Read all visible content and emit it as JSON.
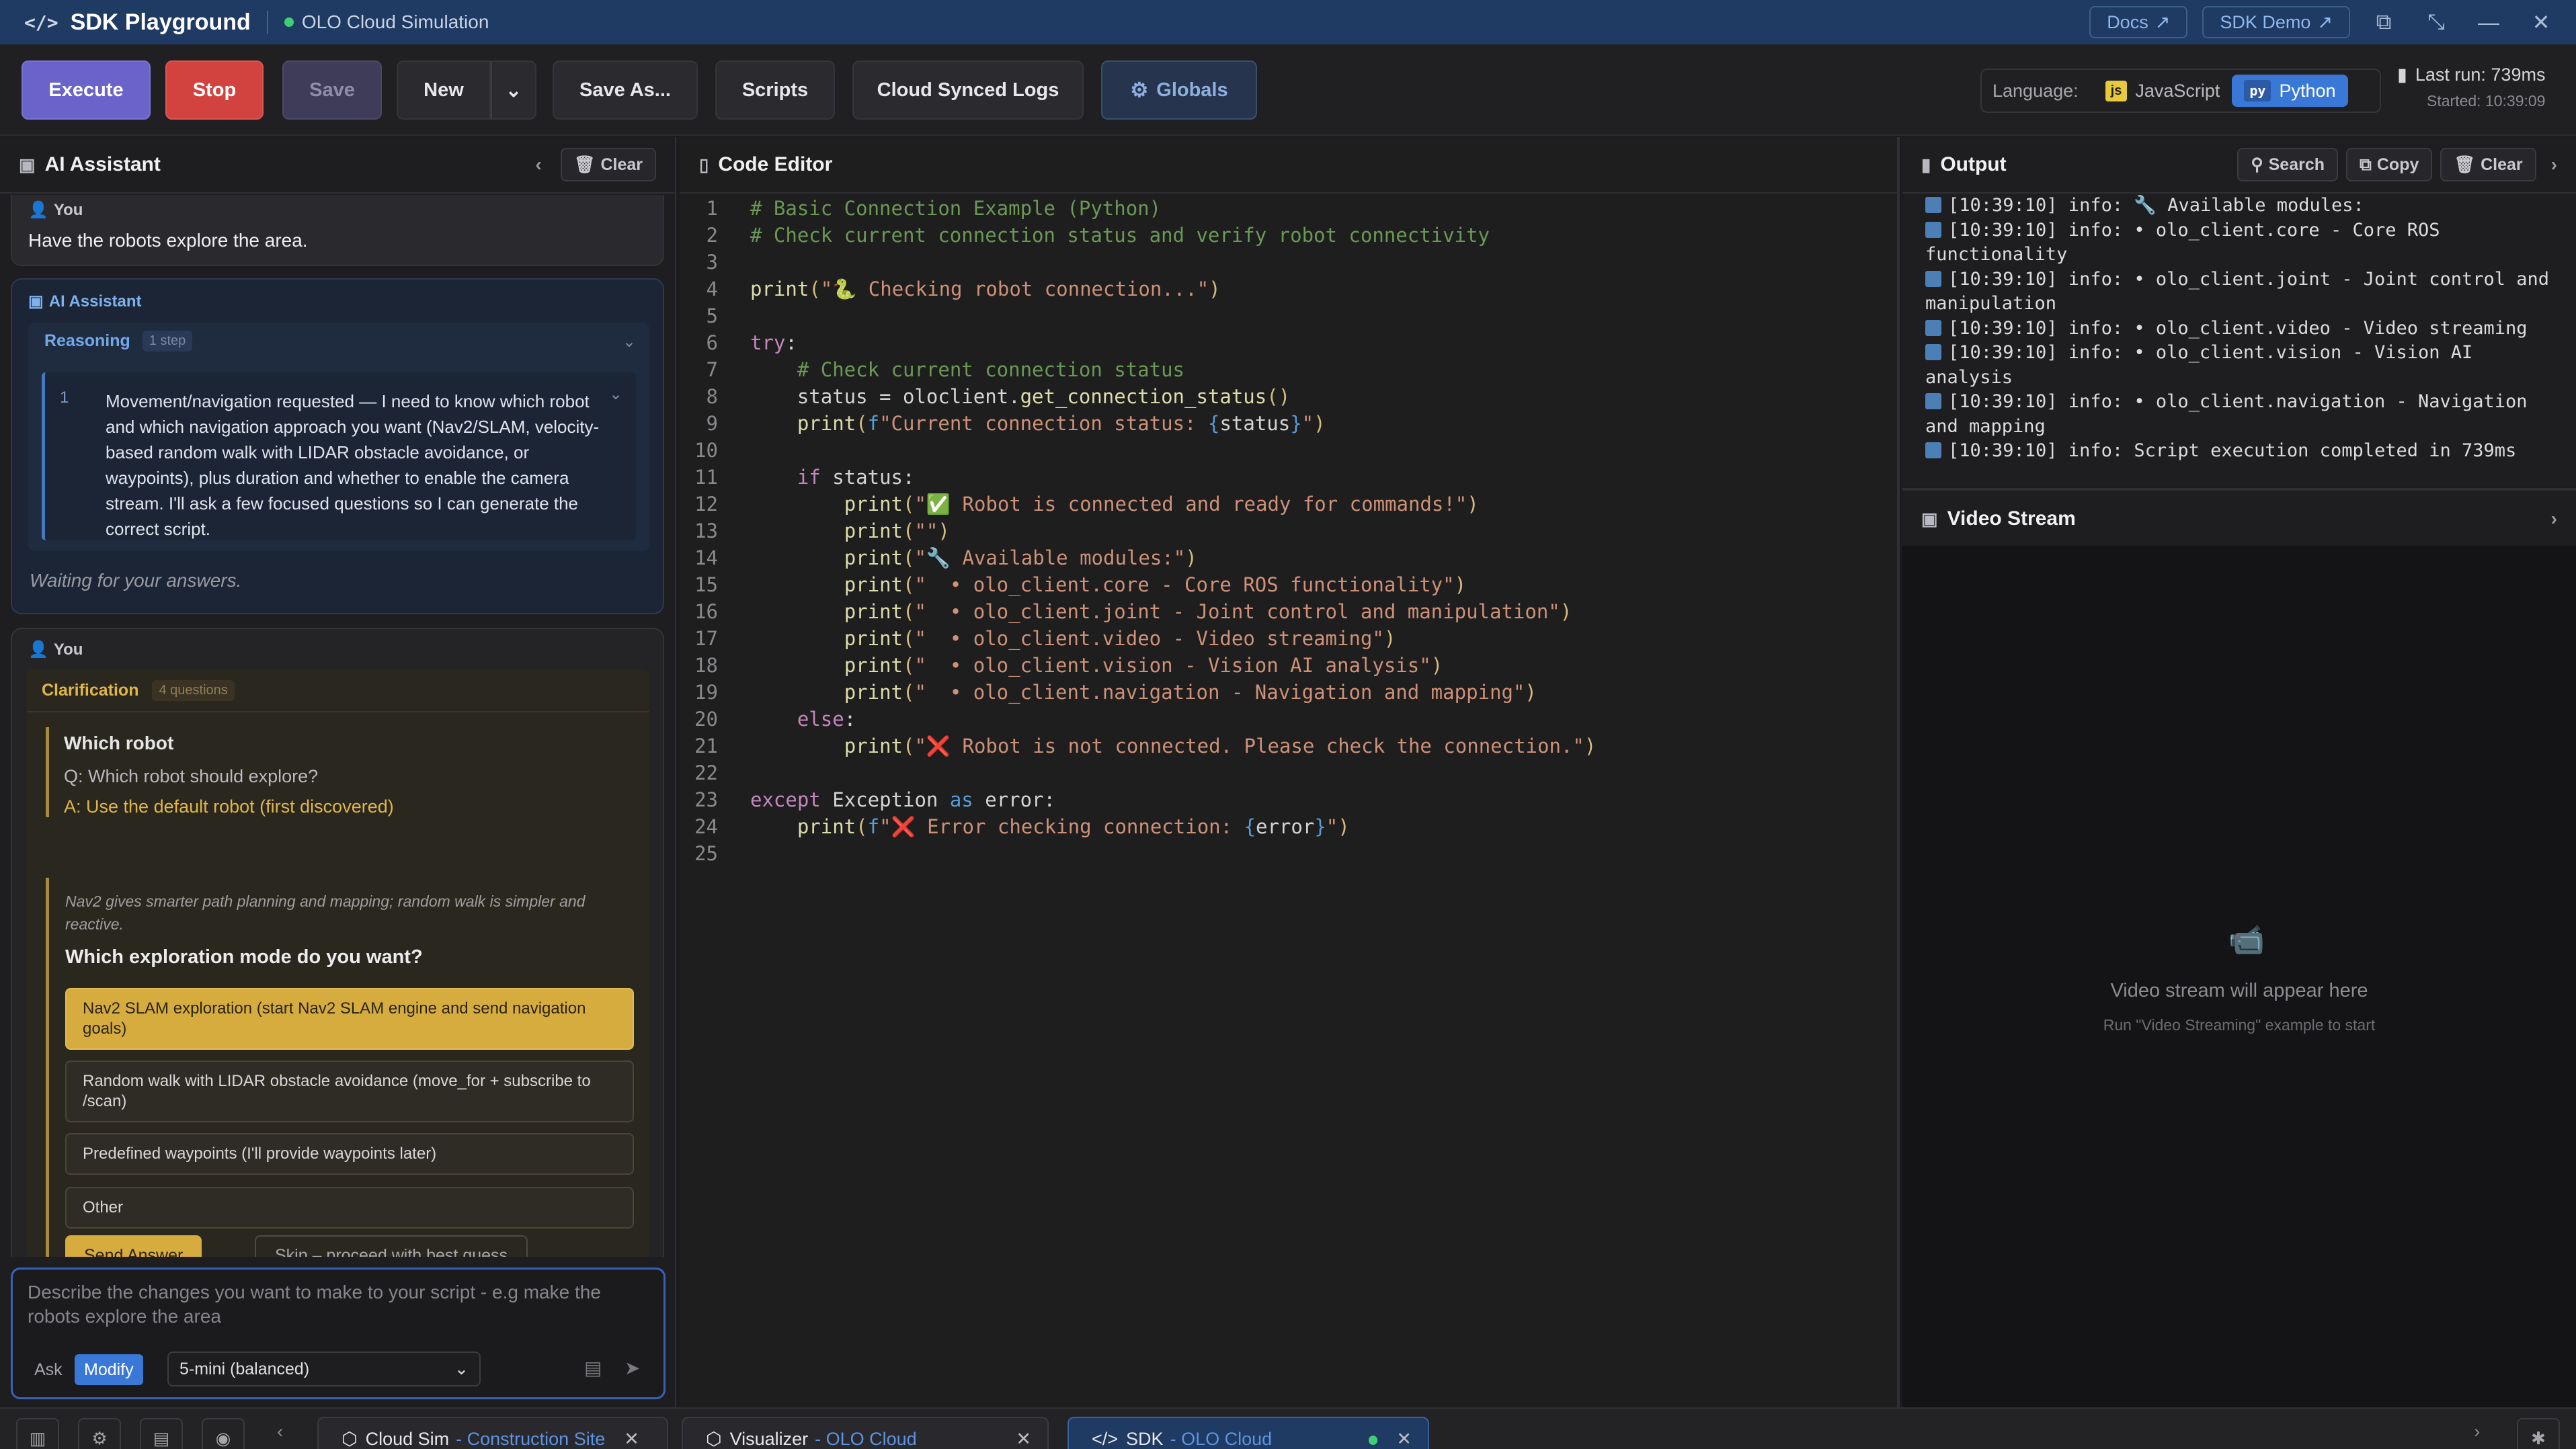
{
  "titlebar": {
    "app_name": "SDK Playground",
    "sim_name": "OLO Cloud Simulation",
    "docs": "Docs",
    "sdk_demo": "SDK Demo"
  },
  "toolbar": {
    "execute": "Execute",
    "stop": "Stop",
    "save": "Save",
    "new": "New",
    "save_as": "Save As...",
    "scripts": "Scripts",
    "cloud_logs": "Cloud Synced Logs",
    "globals": "Globals",
    "language_label": "Language:",
    "lang_js": "JavaScript",
    "lang_py": "Python",
    "lang_js_badge": "js",
    "lang_py_badge": "py",
    "last_run": "Last run: 739ms",
    "started": "Started: 10:39:09"
  },
  "assistant": {
    "title": "AI Assistant",
    "clear": "Clear",
    "you_label": "You",
    "user_msg": "Have the robots explore the area.",
    "ai_label": "AI Assistant",
    "reasoning": "Reasoning",
    "reasoning_count": "1 step",
    "step_num": "1",
    "step_text": "Movement/navigation requested — I need to know which robot and which navigation approach you want (Nav2/SLAM, velocity-based random walk with LIDAR obstacle avoidance, or waypoints), plus duration and whether to enable the camera stream. I'll ask a few focused questions so I can generate the correct script.",
    "waiting": "Waiting for your answers.",
    "you_label2": "You",
    "clarification": "Clarification",
    "clar_count": "4 questions",
    "q1_title": "Which robot",
    "q1_question": "Q: Which robot should explore?",
    "q1_answer": "A: Use the default robot (first discovered)",
    "q2_hint": "Nav2 gives smarter path planning and mapping; random walk is simpler and reactive.",
    "q2_title": "Which exploration mode do you want?",
    "options": [
      "Nav2 SLAM exploration (start Nav2 SLAM engine and send navigation goals)",
      "Random walk with LIDAR obstacle avoidance (move_for + subscribe to /scan)",
      "Predefined waypoints (I'll provide waypoints later)",
      "Other"
    ],
    "send_answer": "Send Answer",
    "skip": "Skip – proceed with best guess",
    "input_placeholder": "Describe the changes you want to make to your script - e.g make the robots explore the area",
    "mode_ask": "Ask",
    "mode_modify": "Modify",
    "model": "5-mini (balanced)"
  },
  "editor": {
    "title": "Code Editor"
  },
  "output": {
    "title": "Output",
    "search": "Search",
    "copy": "Copy",
    "clear": "Clear",
    "lines": [
      "[10:39:10] info: 🔧 Available modules:",
      "[10:39:10] info:   • olo_client.core - Core ROS functionality",
      "[10:39:10] info:   • olo_client.joint - Joint control and manipulation",
      "[10:39:10] info:   • olo_client.video - Video streaming",
      "[10:39:10] info:   • olo_client.vision - Vision AI analysis",
      "[10:39:10] info:   • olo_client.navigation - Navigation and mapping",
      "[10:39:10] info: Script execution completed in 739ms"
    ]
  },
  "video": {
    "title": "Video Stream",
    "placeholder": "Video stream will appear here",
    "hint": "Run \"Video Streaming\" example to start"
  },
  "tabs": [
    {
      "name": "Cloud Sim",
      "sub": "- Construction Site"
    },
    {
      "name": "Visualizer",
      "sub": "- OLO Cloud Simulat..."
    },
    {
      "name": "SDK",
      "sub": "- OLO Cloud Simulation"
    }
  ]
}
